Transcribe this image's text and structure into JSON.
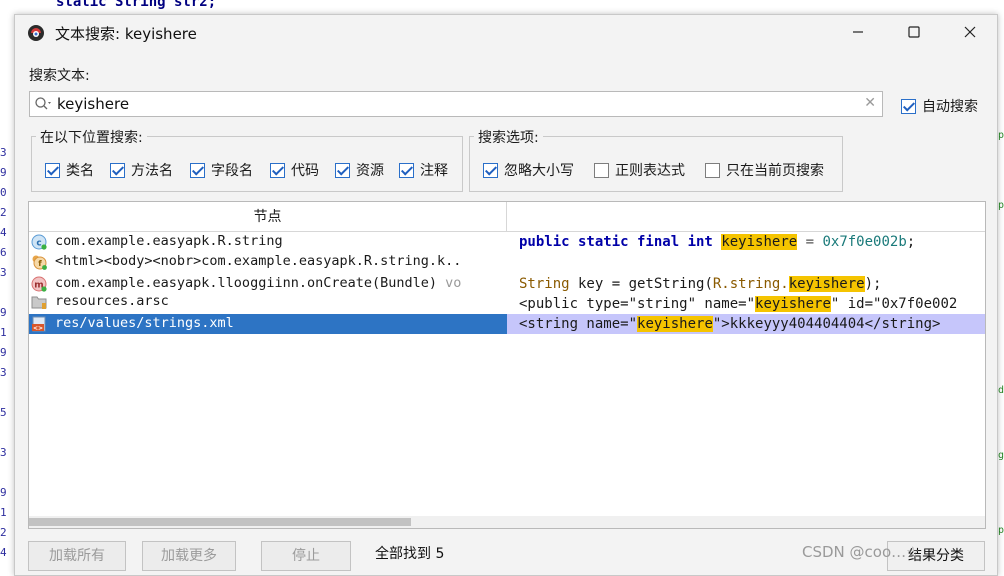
{
  "background": {
    "code_line": "static String str2;",
    "gutter_numbers": [
      "3",
      "9",
      "0",
      "2",
      "4",
      "6",
      "3",
      "9",
      "1",
      "9",
      "3",
      "5",
      "3",
      "9",
      "1",
      "2",
      "4"
    ],
    "right_marks": [
      "p",
      "p",
      "d",
      "g",
      "p"
    ]
  },
  "dialog": {
    "title": "文本搜索: keyishere",
    "window_buttons": {
      "minimize": "—",
      "maximize": "☐",
      "close": "✕"
    }
  },
  "search": {
    "label": "搜索文本:",
    "value": "keyishere",
    "clear_icon": "✕",
    "auto_search": {
      "label": "自动搜索",
      "checked": true
    }
  },
  "locations": {
    "title": "在以下位置搜索:",
    "items": [
      {
        "label": "类名",
        "checked": true
      },
      {
        "label": "方法名",
        "checked": true
      },
      {
        "label": "字段名",
        "checked": true
      },
      {
        "label": "代码",
        "checked": true
      },
      {
        "label": "资源",
        "checked": true
      },
      {
        "label": "注释",
        "checked": true
      }
    ]
  },
  "options": {
    "title": "搜索选项:",
    "items": [
      {
        "label": "忽略大小写",
        "checked": true
      },
      {
        "label": "正则表达式",
        "checked": false
      },
      {
        "label": "只在当前页搜索",
        "checked": false
      }
    ]
  },
  "results": {
    "columns": {
      "node": "节点",
      "code": ""
    },
    "rows": [
      {
        "icon": "class-icon",
        "node": "com.example.easyapk.R.string",
        "node_extra": "",
        "code": {
          "pre_kw": "public static final int",
          "match": "keyishere",
          "post": " = ",
          "num": "0x7f0e002b",
          "tail": ";"
        }
      },
      {
        "icon": "field-icon",
        "node": "<html><body><nobr>com.example.easyapk.R.string.k..",
        "node_extra": "",
        "code": null
      },
      {
        "icon": "method-icon",
        "node": "com.example.easyapk.llooggiinn.onCreate(Bundle)",
        "node_extra": " vo",
        "code": {
          "pre_type": "String",
          "pre": " key = getString(",
          "pre2": "R.string.",
          "match": "keyishere",
          "tail": ");"
        }
      },
      {
        "icon": "folder-icon",
        "node": "resources.arsc",
        "node_extra": "",
        "code": {
          "pre": "<public type=\"string\" name=\"",
          "match": "keyishere",
          "tail": "\" id=\"0x7f0e002"
        }
      },
      {
        "icon": "xml-file-icon",
        "node": "res/values/strings.xml",
        "node_extra": "",
        "selected": true,
        "code": {
          "pre": "<string name=\"",
          "match": "keyishere",
          "tail": "\">kkkeyyy404404404</string>"
        }
      }
    ]
  },
  "footer": {
    "load_all": "加载所有",
    "load_more": "加载更多",
    "stop": "停止",
    "status": "全部找到  5",
    "categorize": "结果分类",
    "watermark": "CSDN @coo…☆"
  },
  "colors": {
    "selection": "#2d74c4",
    "match_highlight": "#f5c400",
    "code_selection": "#c6c6fb",
    "keyword": "#0000a8"
  }
}
